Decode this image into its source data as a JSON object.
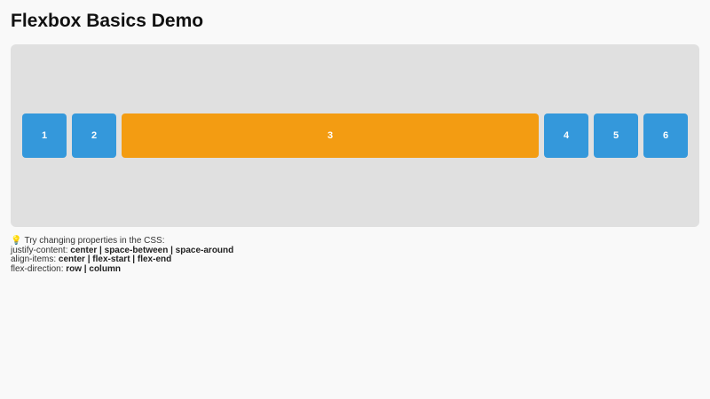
{
  "page": {
    "title": "Flexbox Basics Demo"
  },
  "flex_demo": {
    "items": [
      {
        "label": "1",
        "color": "#3498db",
        "grow": false
      },
      {
        "label": "2",
        "color": "#3498db",
        "grow": false
      },
      {
        "label": "3",
        "color": "#f39c12",
        "grow": true
      },
      {
        "label": "4",
        "color": "#3498db",
        "grow": false
      },
      {
        "label": "5",
        "color": "#3498db",
        "grow": false
      },
      {
        "label": "6",
        "color": "#3498db",
        "grow": false
      }
    ]
  },
  "notes": {
    "icon": "lightbulb-icon",
    "intro": "Try changing properties in the CSS:",
    "lines": [
      {
        "property": "justify-content:",
        "values": "center | space-between | space-around"
      },
      {
        "property": "align-items:",
        "values": "center | flex-start | flex-end"
      },
      {
        "property": "flex-direction:",
        "values": "row | column"
      }
    ]
  },
  "colors": {
    "background": "#f9f9f9",
    "container": "#e0e0e0",
    "item_blue": "#3498db",
    "item_orange": "#f39c12"
  }
}
